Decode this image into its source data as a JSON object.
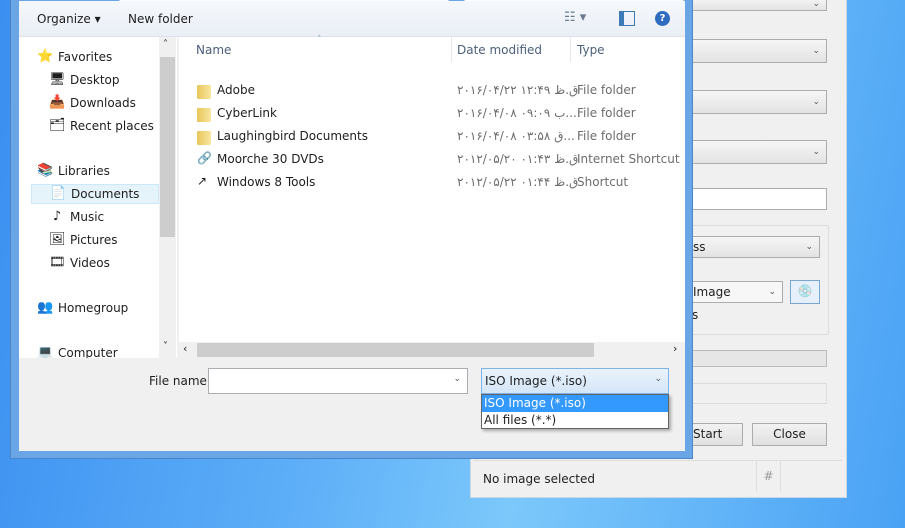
{
  "dialog": {
    "toolbar": {
      "organize": "Organize ▾",
      "new_folder": "New folder"
    },
    "nav": [
      {
        "label": "Favorites",
        "icon": "star-icon",
        "level": 0
      },
      {
        "label": "Desktop",
        "icon": "desktop-icon",
        "level": 1
      },
      {
        "label": "Downloads",
        "icon": "downloads-icon",
        "level": 1
      },
      {
        "label": "Recent places",
        "icon": "recent-places-icon",
        "level": 1
      },
      {
        "label": "Libraries",
        "icon": "libraries-icon",
        "level": 0
      },
      {
        "label": "Documents",
        "icon": "documents-icon",
        "level": 1,
        "selected": true
      },
      {
        "label": "Music",
        "icon": "music-icon",
        "level": 1
      },
      {
        "label": "Pictures",
        "icon": "pictures-icon",
        "level": 1
      },
      {
        "label": "Videos",
        "icon": "videos-icon",
        "level": 1
      },
      {
        "label": "Homegroup",
        "icon": "homegroup-icon",
        "level": 0
      },
      {
        "label": "Computer",
        "icon": "computer-icon",
        "level": 0
      }
    ],
    "columns": {
      "name": "Name",
      "date": "Date modified",
      "type": "Type"
    },
    "files": [
      {
        "name": "Adobe",
        "date": "۲۰۱۶/۰۴/۲۲ ق.ظ ۱۲:۴۹",
        "type": "File folder",
        "icon": "folder-icon"
      },
      {
        "name": "CyberLink",
        "date": "۲۰۱۶/۰۴/۰۸ ب ۰۹:۰۹....",
        "type": "File folder",
        "icon": "folder-icon"
      },
      {
        "name": "Laughingbird Documents",
        "date": "۲۰۱۶/۰۴/۰۸ ق ۰۳:۵۸...",
        "type": "File folder",
        "icon": "folder-icon"
      },
      {
        "name": "Moorche 30 DVDs",
        "date": "۲۰۱۲/۰۵/۲۰ ق.ظ ۰۱:۴۳",
        "type": "Internet Shortcut",
        "icon": "internet-shortcut-icon"
      },
      {
        "name": "Windows 8 Tools",
        "date": "۲۰۱۲/۰۵/۲۲ ق.ظ ۰۱:۴۴",
        "type": "Shortcut",
        "icon": "shortcut-icon"
      }
    ],
    "file_name_label": "File name:",
    "file_name_value": "",
    "file_type_selected": "ISO Image (*.iso)",
    "file_type_options": [
      "ISO Image (*.iso)",
      "All files (*.*)"
    ]
  },
  "background_app": {
    "combo_partial_1": "ss",
    "combo_partial_2": "Image",
    "text_partial": "s",
    "start": "Start",
    "close": "Close",
    "status": "No image selected",
    "status_hash": "#"
  },
  "colors": {
    "selection": "#3399ff",
    "accent": "#6aa6e6"
  }
}
